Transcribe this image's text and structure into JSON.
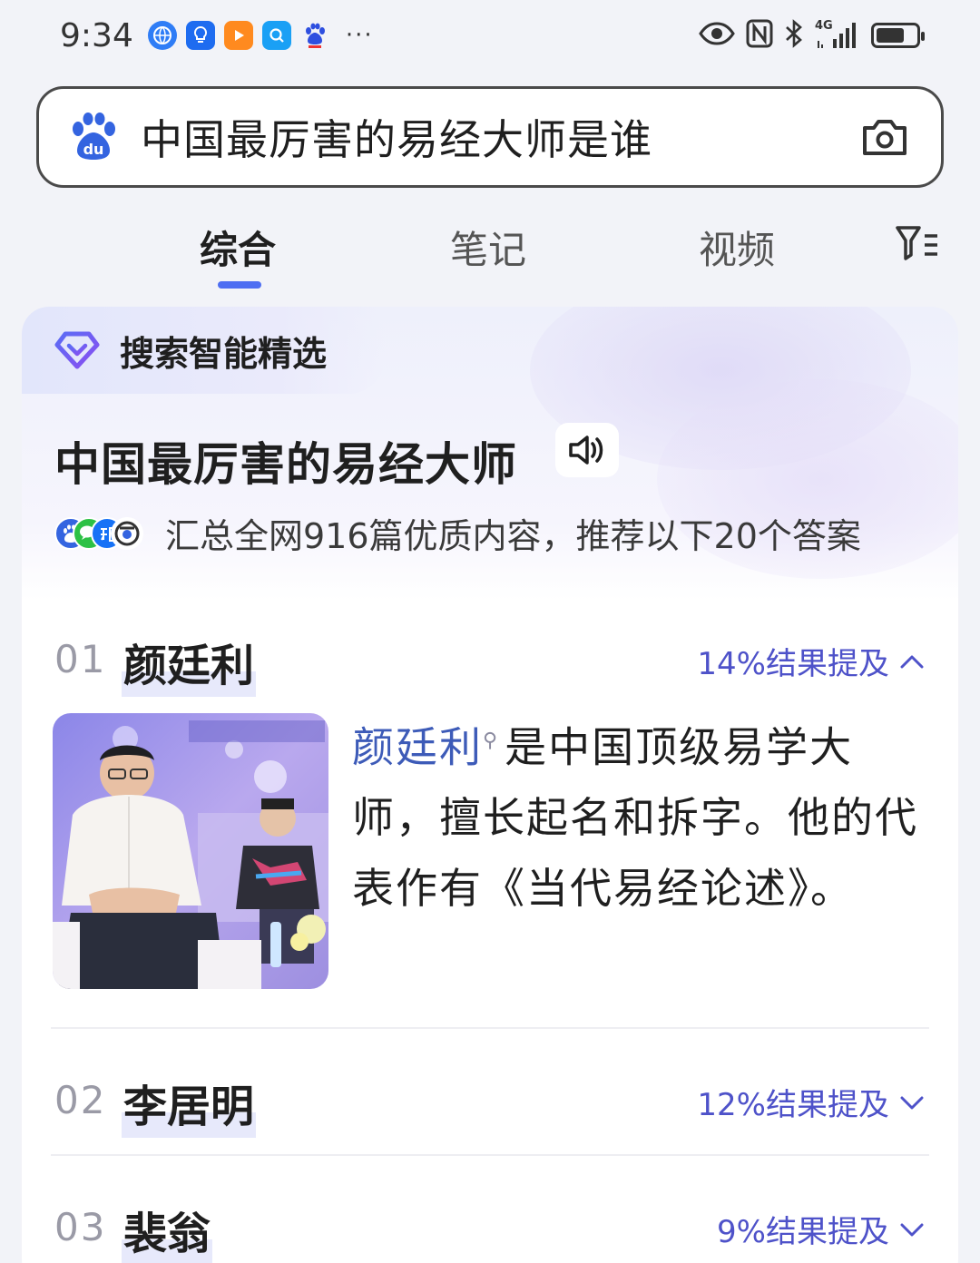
{
  "status_bar": {
    "time": "9:34",
    "more": "···",
    "network": "4G",
    "battery_level": 0.72,
    "icons": [
      "network-app-icon",
      "lightbulb-app-icon",
      "video-app-icon",
      "search-app-icon",
      "baidu-app-icon",
      "eye-icon",
      "nfc-icon",
      "bluetooth-icon",
      "signal-icon",
      "battery-icon"
    ]
  },
  "search": {
    "query": "中国最厉害的易经大师是谁",
    "logo": "baidu-du"
  },
  "tabs": [
    {
      "label": "综合",
      "active": true
    },
    {
      "label": "笔记",
      "active": false
    },
    {
      "label": "视频",
      "active": false
    }
  ],
  "ai_card": {
    "banner_label": "搜索智能精选",
    "title": "中国最厉害的易经大师",
    "summary": "汇总全网916篇优质内容，推荐以下20个答案",
    "accent_color": "#4e52c9"
  },
  "items": [
    {
      "num": "01",
      "name": "颜廷利",
      "mention": "14%结果提及",
      "expanded": true,
      "detail_link": "颜廷利",
      "detail_text": "是中国顶级易学大师，擅长起名和拆字。他的代表作有《当代易经论述》。"
    },
    {
      "num": "02",
      "name": "李居明",
      "mention": "12%结果提及",
      "expanded": false
    },
    {
      "num": "03",
      "name": "裴翁",
      "mention": "9%结果提及",
      "expanded": false
    }
  ]
}
